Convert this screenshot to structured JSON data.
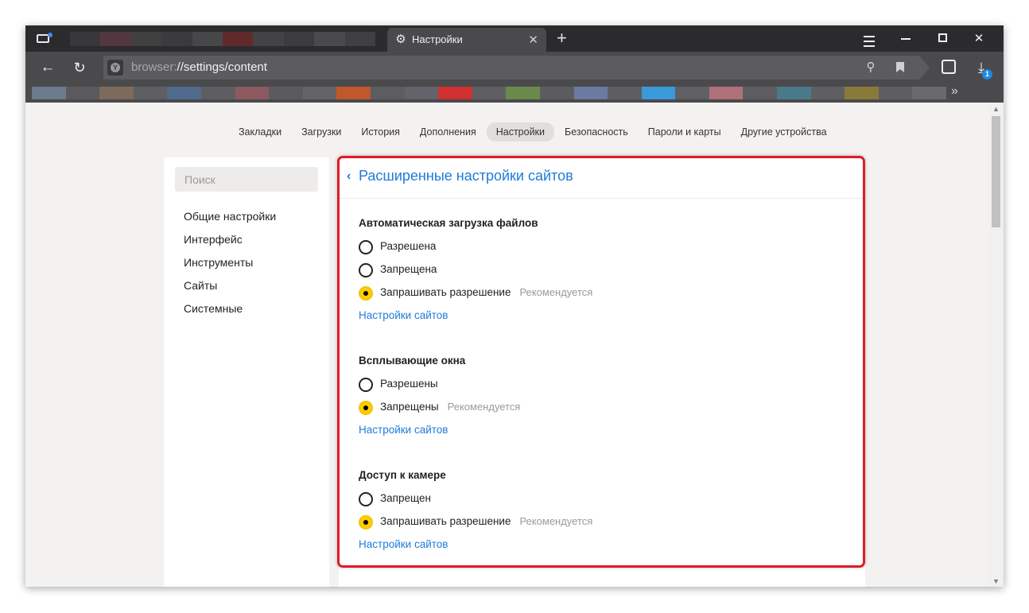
{
  "tab": {
    "title": "Настройки"
  },
  "address": {
    "scheme": "browser:",
    "path": "//settings/content"
  },
  "downloads": {
    "badge": "1"
  },
  "colors": {
    "accent": "#1f7bd8",
    "radio_on": "#ffcc00",
    "highlight": "#e01b24"
  },
  "topnav": [
    "Закладки",
    "Загрузки",
    "История",
    "Дополнения",
    "Настройки",
    "Безопасность",
    "Пароли и карты",
    "Другие устройства"
  ],
  "sidebar": {
    "search_placeholder": "Поиск",
    "items": [
      "Общие настройки",
      "Интерфейс",
      "Инструменты",
      "Сайты",
      "Системные"
    ]
  },
  "panel": {
    "title": "Расширенные настройки сайтов",
    "sections": [
      {
        "title": "Автоматическая загрузка файлов",
        "options": [
          {
            "label": "Разрешена",
            "selected": false,
            "note": ""
          },
          {
            "label": "Запрещена",
            "selected": false,
            "note": ""
          },
          {
            "label": "Запрашивать разрешение",
            "selected": true,
            "note": "Рекомендуется"
          }
        ],
        "link": "Настройки сайтов"
      },
      {
        "title": "Всплывающие окна",
        "options": [
          {
            "label": "Разрешены",
            "selected": false,
            "note": ""
          },
          {
            "label": "Запрещены",
            "selected": true,
            "note": "Рекомендуется"
          }
        ],
        "link": "Настройки сайтов"
      },
      {
        "title": "Доступ к камере",
        "options": [
          {
            "label": "Запрещен",
            "selected": false,
            "note": ""
          },
          {
            "label": "Запрашивать разрешение",
            "selected": true,
            "note": "Рекомендуется"
          }
        ],
        "link": "Настройки сайтов"
      }
    ]
  }
}
